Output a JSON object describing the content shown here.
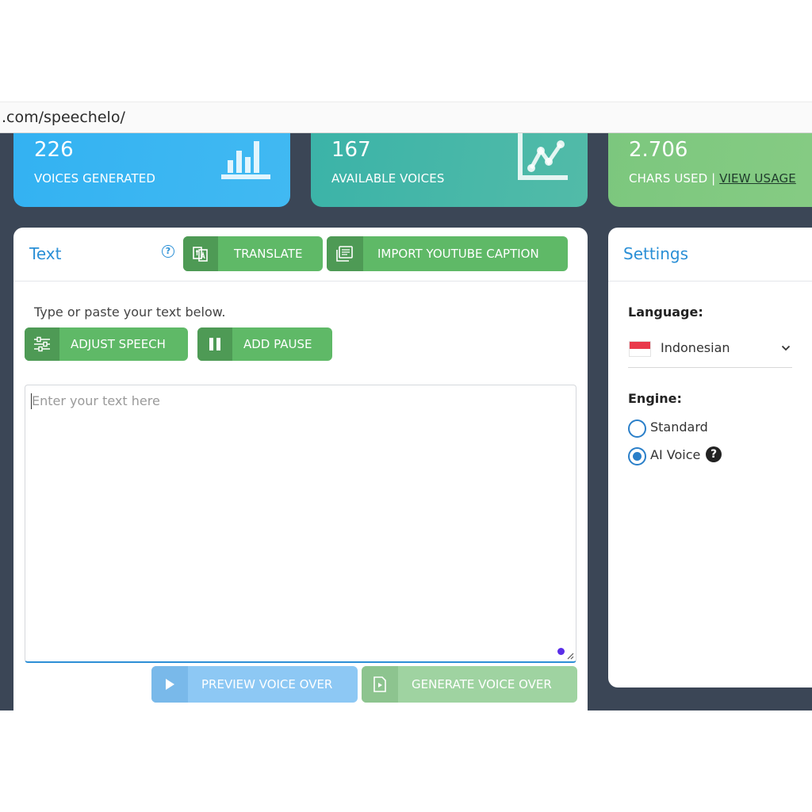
{
  "browser": {
    "url": ".com/speechelo/"
  },
  "stats": [
    {
      "value": "226",
      "label": "VOICES GENERATED",
      "icon": "bar-chart-icon"
    },
    {
      "value": "167",
      "label": "AVAILABLE VOICES",
      "icon": "line-chart-icon"
    },
    {
      "value": "2.706",
      "label": "CHARS USED | ",
      "link": "VIEW USAGE"
    }
  ],
  "text_panel": {
    "title": "Text",
    "help_symbol": "?",
    "translate_label": "TRANSLATE",
    "import_label": "IMPORT YOUTUBE CAPTION",
    "hint": "Type or paste your text below.",
    "adjust_label": "ADJUST SPEECH",
    "pause_label": "ADD PAUSE",
    "placeholder": "Enter your text here",
    "preview_label": "PREVIEW VOICE OVER",
    "generate_label": "GENERATE VOICE OVER"
  },
  "settings_panel": {
    "title": "Settings",
    "language_label": "Language:",
    "language_value": "Indonesian",
    "engine_label": "Engine:",
    "engines": [
      {
        "label": "Standard",
        "selected": false
      },
      {
        "label": "AI Voice",
        "selected": true
      }
    ],
    "help_symbol": "?"
  },
  "colors": {
    "accent_blue": "#2a8fd6",
    "button_green": "#5fb967",
    "app_bg": "#3b4656"
  }
}
